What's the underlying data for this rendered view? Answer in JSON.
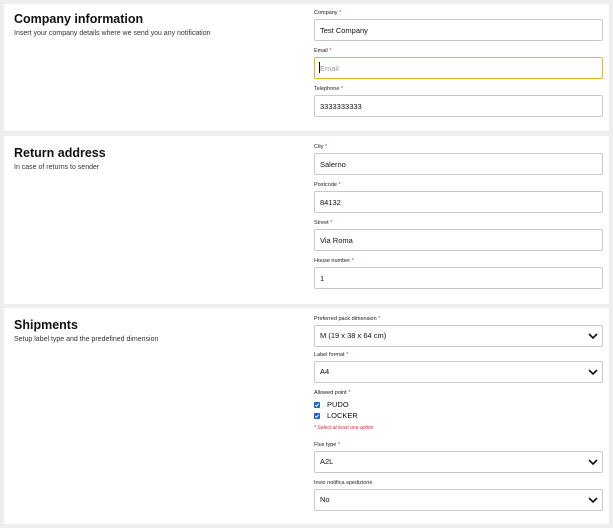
{
  "company": {
    "title": "Company information",
    "subtitle": "Insert your company details where we send you any notification",
    "fields": [
      {
        "label": "Company",
        "required": "*",
        "value": "Test Company",
        "placeholder": ""
      },
      {
        "label": "Email",
        "required": "*",
        "value": "",
        "placeholder": "Email"
      },
      {
        "label": "Telephone",
        "required": "*",
        "value": "3333333333",
        "placeholder": ""
      }
    ]
  },
  "return_address": {
    "title": "Return address",
    "subtitle": "In case of returns to sender",
    "fields": [
      {
        "label": "City",
        "required": "*",
        "value": "Salerno"
      },
      {
        "label": "Postcode",
        "required": "*",
        "value": "84132"
      },
      {
        "label": "Street",
        "required": "*",
        "value": "Via Roma"
      },
      {
        "label": "House number",
        "required": "*",
        "value": "1"
      }
    ]
  },
  "shipments": {
    "title": "Shipments",
    "subtitle": "Setup label type and the predefined dimension",
    "pack_dimension": {
      "label": "Preferred pack dimension",
      "required": "*",
      "value": "M (19 x 38 x 64 cm)"
    },
    "label_format": {
      "label": "Label format",
      "required": "*",
      "value": "A4"
    },
    "allowed_point": {
      "label": "Allowed point",
      "required": "*",
      "options": [
        {
          "label": "PUDO",
          "checked": true
        },
        {
          "label": "LOCKER",
          "checked": true
        }
      ],
      "hint": "* Select at least one option"
    },
    "flux_type": {
      "label": "Flux type",
      "required": "*",
      "value": "A2L"
    },
    "invio_notifica": {
      "label": "Invio notifica spedizione",
      "value": "No"
    }
  }
}
